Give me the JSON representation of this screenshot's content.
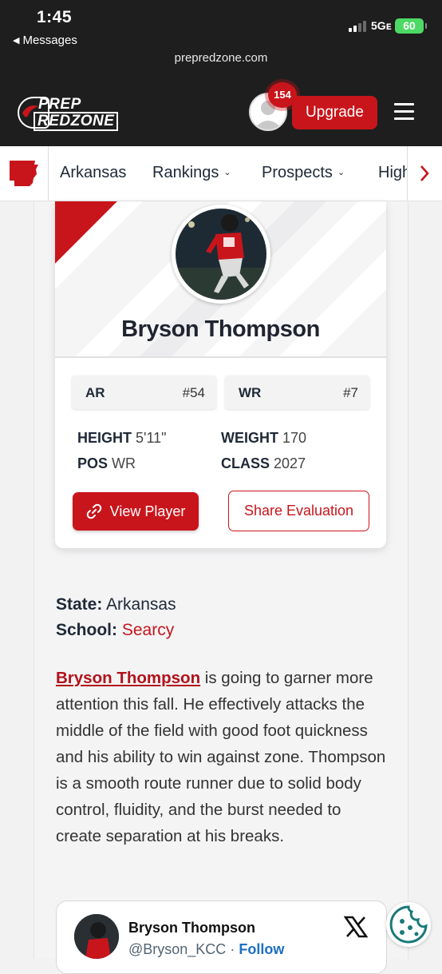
{
  "status_bar": {
    "time": "1:45",
    "back_app": "Messages",
    "network": "5Gᴇ",
    "battery": "60"
  },
  "browser": {
    "url": "prepredzone.com"
  },
  "header": {
    "logo_line1": "PREP",
    "logo_line2": "REDZONE",
    "notification_count": "154",
    "upgrade_label": "Upgrade"
  },
  "nav": {
    "state_label": "Arkansas",
    "rankings_label": "Rankings",
    "prospects_label": "Prospects",
    "high_label": "High"
  },
  "player": {
    "name": "Bryson Thompson",
    "state_code": "AR",
    "state_rank": "#54",
    "position_code": "WR",
    "position_rank": "#7",
    "height_label": "HEIGHT",
    "height": "5'11\"",
    "weight_label": "WEIGHT",
    "weight": "170",
    "pos_label": "POS",
    "pos": "WR",
    "class_label": "CLASS",
    "class_year": "2027",
    "view_player_label": "View Player",
    "share_label": "Share Evaluation"
  },
  "info": {
    "state_label": "State:",
    "state_value": "Arkansas",
    "school_label": "School:",
    "school_value": "Searcy"
  },
  "article": {
    "name_link": "Bryson Thompson",
    "body": " is going to garner more attention this fall. He effectively attacks the middle of the field with good foot quickness and his ability to win against zone. Thompson is a smooth route runner due to solid body control, fluidity, and the burst needed to create separation at his breaks."
  },
  "tweet": {
    "name": "Bryson Thompson",
    "handle": "@Bryson_KCC",
    "separator": "·",
    "follow_label": "Follow"
  },
  "colors": {
    "brand_red": "#c8151b",
    "header_bg": "#1e1e1e",
    "text_dark": "#1f2937"
  }
}
